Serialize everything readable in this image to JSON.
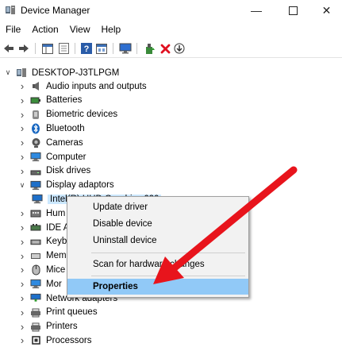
{
  "window": {
    "title": "Device Manager",
    "minimize_icon": "minimize-icon",
    "maximize_icon": "maximize-icon",
    "close_icon": "close-icon"
  },
  "menu": [
    "File",
    "Action",
    "View",
    "Help"
  ],
  "toolbar": [
    "back-arrow-icon",
    "forward-arrow-icon",
    "show-hide-console-tree-icon",
    "properties-icon",
    "help-icon",
    "view-icon",
    "monitor-scan-icon",
    "update-driver-icon",
    "uninstall-red-x-icon",
    "download-arrow-icon"
  ],
  "tree": {
    "root": "DESKTOP-J3TLPGM",
    "items": [
      {
        "label": "Audio inputs and outputs",
        "icon": "speaker-icon"
      },
      {
        "label": "Batteries",
        "icon": "battery-icon"
      },
      {
        "label": "Biometric devices",
        "icon": "biometric-icon"
      },
      {
        "label": "Bluetooth",
        "icon": "bluetooth-icon"
      },
      {
        "label": "Cameras",
        "icon": "camera-icon"
      },
      {
        "label": "Computer",
        "icon": "computer-icon"
      },
      {
        "label": "Disk drives",
        "icon": "disk-drive-icon"
      },
      {
        "label": "Display adaptors",
        "icon": "display-icon"
      },
      {
        "label": "Intel(R) UHD Graphics 620",
        "icon": "display-adapter-icon"
      },
      {
        "label": "Hum",
        "icon": "human-interface-icon"
      },
      {
        "label": "IDE A",
        "icon": "ide-controller-icon"
      },
      {
        "label": "Keyb",
        "icon": "keyboard-icon"
      },
      {
        "label": "Mem",
        "icon": "memory-icon"
      },
      {
        "label": "Mice",
        "icon": "mouse-icon"
      },
      {
        "label": "Mor",
        "icon": "monitor-icon"
      },
      {
        "label": "Network adapters",
        "icon": "network-icon"
      },
      {
        "label": "Print queues",
        "icon": "print-queue-icon"
      },
      {
        "label": "Printers",
        "icon": "printer-icon"
      },
      {
        "label": "Processors",
        "icon": "processor-icon"
      }
    ]
  },
  "context_menu": {
    "items": [
      "Update driver",
      "Disable device",
      "Uninstall device",
      "Scan for hardware changes",
      "Properties"
    ],
    "highlighted": "Properties"
  },
  "colors": {
    "selection": "#cce8ff",
    "menu_highlight": "#91c9f7",
    "arrow": "#e8141c",
    "display_icon": "#1e6fc9"
  }
}
